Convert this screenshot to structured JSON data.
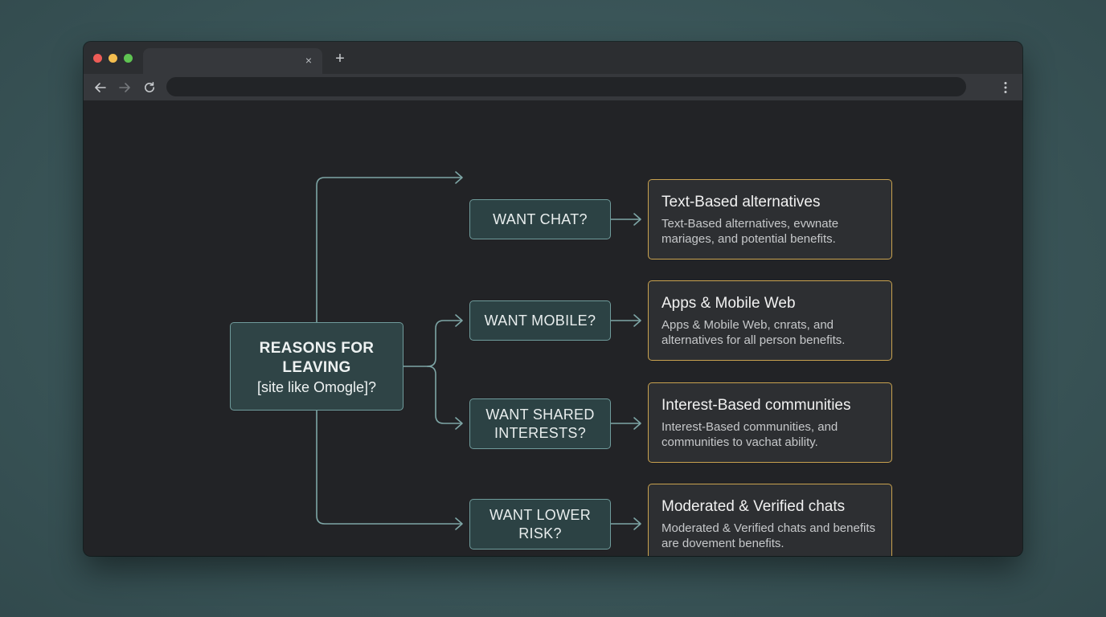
{
  "browser": {
    "tab_close_glyph": "×",
    "new_tab_glyph": "+",
    "address": ""
  },
  "flowchart": {
    "root": {
      "title_line1": "REASONS FOR",
      "title_line2": "LEAVING",
      "subtitle": "[site like Omogle]?"
    },
    "questions": [
      "WANT CHAT?",
      "WANT MOBILE?",
      "WANT SHARED INTERESTS?",
      "WANT LOWER RISK?"
    ],
    "cards": [
      {
        "title": "Text-Based alternatives",
        "body": "Text-Based alternatives, evwnate mariages, and potential benefits."
      },
      {
        "title": "Apps & Mobile Web",
        "body": "Apps & Mobile Web, cnrats, and alternatives for all person benefits."
      },
      {
        "title": "Interest-Based communities",
        "body": "Interest-Based communities, and communities to vachat ability."
      },
      {
        "title": "Moderated & Verified chats",
        "body": "Moderated & Verified chats and benefits are dovement benefits."
      }
    ]
  },
  "colors": {
    "background": "#3a5558",
    "node_border": "#6f9b9b",
    "node_fill": "#2c4244",
    "card_border": "#c9a24f",
    "connector": "#7ea6a6"
  }
}
